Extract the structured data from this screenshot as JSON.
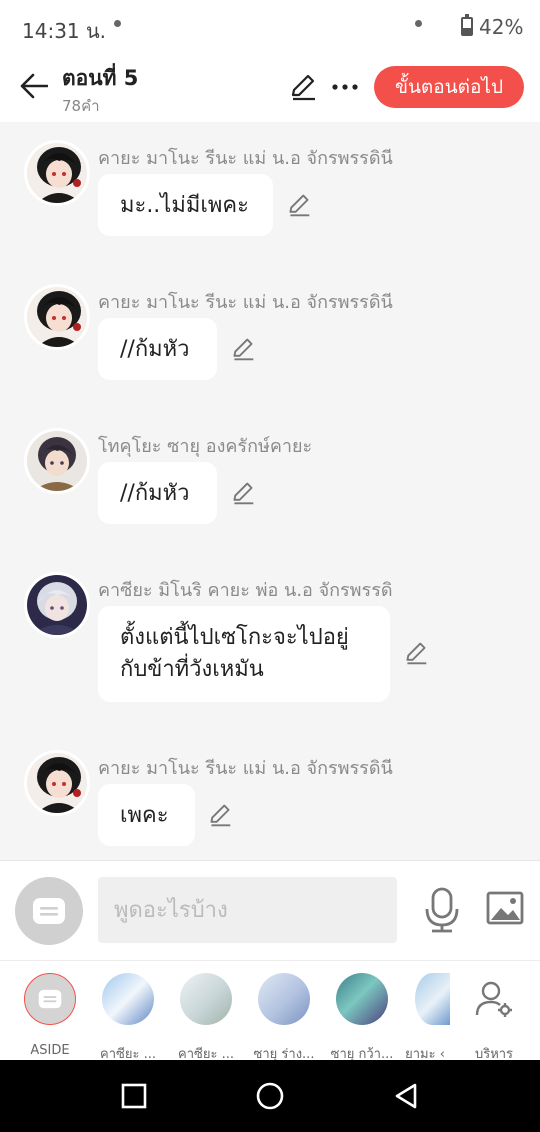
{
  "status": {
    "time": "14:31 น.",
    "battery_pct": "42%",
    "battery_level": 0.42
  },
  "header": {
    "title": "ตอนที่ 5",
    "word_count": "78คำ",
    "next_label": "ขั้นตอนต่อไป"
  },
  "messages": [
    {
      "character": "คายะ มาโนะ รีนะ แม่ น.อ จักรพรรดินี",
      "text": "มะ..ไม่มีเพคะ"
    },
    {
      "character": "คายะ มาโนะ รีนะ แม่ น.อ จักรพรรดินี",
      "text": "//ก้มหัว"
    },
    {
      "character": "โทคุโยะ ซายุ องครักษ์คายะ",
      "text": "//ก้มหัว"
    },
    {
      "character": "คาซียะ มิโนริ คายะ พ่อ น.อ จักรพรรดิ",
      "text_line1": "ตั้งแต่นี้ไปเซโกะจะไปอยู่",
      "text_line2": "กับข้าที่วังเหมัน"
    },
    {
      "character": "คายะ มาโนะ รีนะ แม่ น.อ จักรพรรดินี",
      "text": "เพคะ"
    }
  ],
  "input": {
    "placeholder": "พูดอะไรบ้าง"
  },
  "characters_bar": [
    {
      "label": "ASIDE"
    },
    {
      "label": "คาซียะ ..."
    },
    {
      "label": "คาซียะ ..."
    },
    {
      "label": "ซายุ ร่าง..."
    },
    {
      "label": "ซายุ กว้า..."
    },
    {
      "label": "ยามะ ‹"
    },
    {
      "label": "บริหาร"
    }
  ],
  "colors": {
    "accent": "#f4504b",
    "background": "#f5f5f5"
  }
}
